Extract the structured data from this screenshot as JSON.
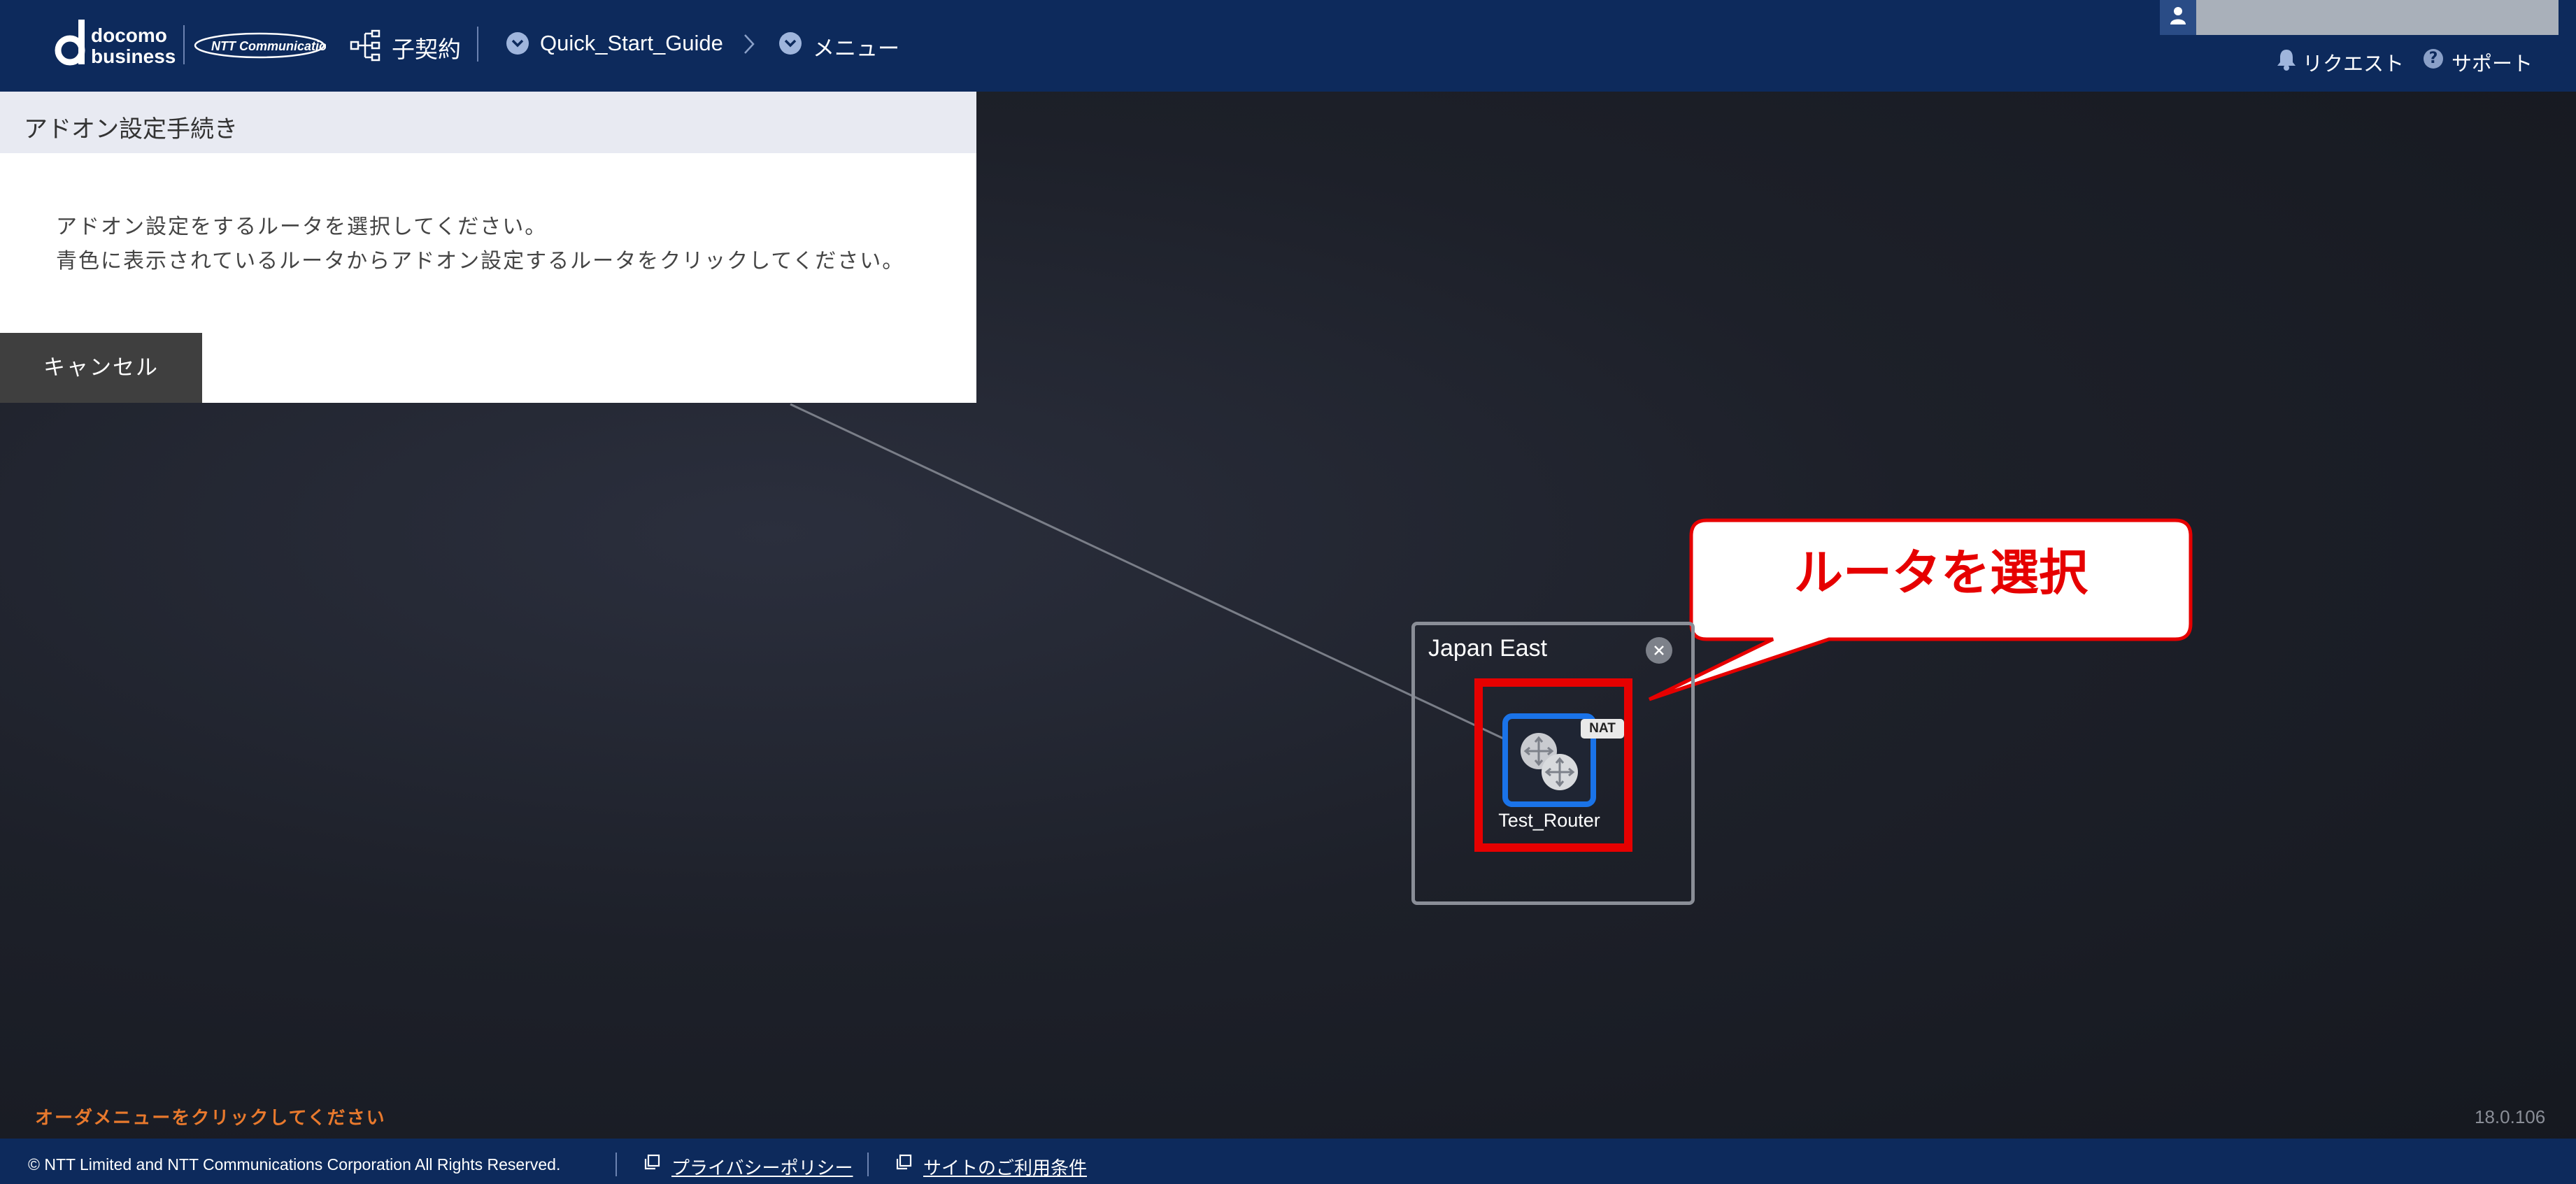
{
  "header": {
    "logo_text_line1": "docomo",
    "logo_text_line2": "business",
    "ntt_logo_text": "NTT Communications",
    "contract_label": "子契約",
    "breadcrumb_guide": "Quick_Start_Guide",
    "menu_label": "メニュー",
    "request_label": "リクエスト",
    "support_label": "サポート"
  },
  "panel": {
    "title": "アドオン設定手続き",
    "line1": "アドオン設定をするルータを選択してください。",
    "line2": "青色に表示されているルータからアドオン設定するルータをクリックしてください。",
    "cancel_label": "キャンセル"
  },
  "topology": {
    "region_title": "Japan East",
    "router_name": "Test_Router",
    "nat_badge": "NAT",
    "router_color": "#1a73e8"
  },
  "callout": {
    "text": "ルータを選択",
    "color": "#e60000"
  },
  "bottom": {
    "hint": "オーダメニューをクリックしてください",
    "version": "18.0.106"
  },
  "footer": {
    "copyright": "© NTT Limited and NTT Communications Corporation All Rights Reserved.",
    "privacy_link": "プライバシーポリシー",
    "terms_link": "サイトのご利用条件"
  }
}
